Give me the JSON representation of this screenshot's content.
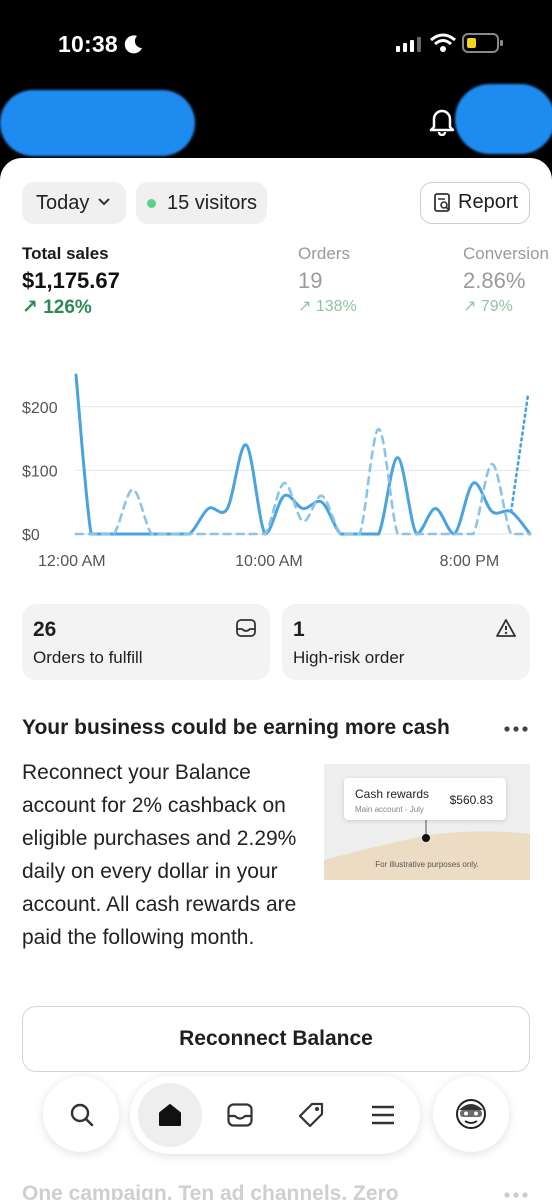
{
  "status_bar": {
    "time": "10:38"
  },
  "filters": {
    "period": "Today",
    "visitors": "15 visitors",
    "report": "Report"
  },
  "metrics": [
    {
      "label": "Total sales",
      "value": "$1,175.67",
      "change": "126%"
    },
    {
      "label": "Orders",
      "value": "19",
      "change": "138%"
    },
    {
      "label": "Conversion",
      "value": "2.86%",
      "change": "79%"
    }
  ],
  "chart_data": {
    "type": "line",
    "x_ticks": [
      "12:00 AM",
      "10:00 AM",
      "8:00 PM"
    ],
    "y_ticks": [
      "$0",
      "$100",
      "$200"
    ],
    "ylim": [
      0,
      250
    ],
    "x_hours": [
      0,
      24
    ],
    "series": [
      {
        "style": "solid",
        "color": "#4aa3df",
        "points": [
          [
            0,
            250
          ],
          [
            0.8,
            0
          ],
          [
            1.5,
            0
          ],
          [
            2.5,
            0
          ],
          [
            4,
            0
          ],
          [
            5,
            0
          ],
          [
            6,
            0
          ],
          [
            7,
            40
          ],
          [
            8,
            40
          ],
          [
            9,
            140
          ],
          [
            10,
            0
          ],
          [
            11,
            60
          ],
          [
            12,
            40
          ],
          [
            13,
            50
          ],
          [
            14,
            0
          ],
          [
            15,
            0
          ],
          [
            16,
            0
          ],
          [
            17,
            120
          ],
          [
            18,
            0
          ],
          [
            19,
            40
          ],
          [
            20,
            0
          ],
          [
            21,
            80
          ],
          [
            22,
            35
          ],
          [
            23,
            35
          ],
          [
            24,
            0
          ]
        ]
      },
      {
        "style": "dashed",
        "color": "#8bc4ea",
        "points": [
          [
            0,
            0
          ],
          [
            1,
            0
          ],
          [
            2,
            0
          ],
          [
            3,
            70
          ],
          [
            4,
            0
          ],
          [
            5,
            0
          ],
          [
            6,
            0
          ],
          [
            7,
            0
          ],
          [
            8,
            0
          ],
          [
            9,
            0
          ],
          [
            10,
            0
          ],
          [
            11,
            80
          ],
          [
            12,
            20
          ],
          [
            13,
            60
          ],
          [
            14,
            0
          ],
          [
            15,
            0
          ],
          [
            16,
            165
          ],
          [
            17,
            0
          ],
          [
            18,
            0
          ],
          [
            19,
            0
          ],
          [
            20,
            0
          ],
          [
            21,
            0
          ],
          [
            22,
            110
          ],
          [
            23,
            0
          ],
          [
            24,
            0
          ]
        ]
      },
      {
        "style": "dotted",
        "color": "#4aa3df",
        "points": [
          [
            23,
            35
          ],
          [
            23.9,
            220
          ]
        ]
      }
    ]
  },
  "tiles": [
    {
      "value": "26",
      "label": "Orders to fulfill",
      "icon": "inbox-icon"
    },
    {
      "value": "1",
      "label": "High-risk order",
      "icon": "warning-icon"
    }
  ],
  "promo": {
    "title": "Your business could be earning more cash",
    "body": "Reconnect your Balance account for 2% cashback on eligible purchases and 2.29% daily on every dollar in your account. All cash rewards are paid the following month.",
    "image": {
      "card_title": "Cash rewards",
      "card_sub": "Main account - July",
      "card_amount": "$560.83",
      "disclaimer": "For illustrative purposes only."
    },
    "button": "Reconnect Balance"
  },
  "next_card_title": "One campaign. Ten ad channels. Zero",
  "nav": [
    "search-icon",
    "home-icon",
    "inbox-icon",
    "tag-icon",
    "menu-icon",
    "avatar"
  ],
  "colors": {
    "accent_green": "#2e8a52",
    "chart_blue": "#4aa3df"
  }
}
